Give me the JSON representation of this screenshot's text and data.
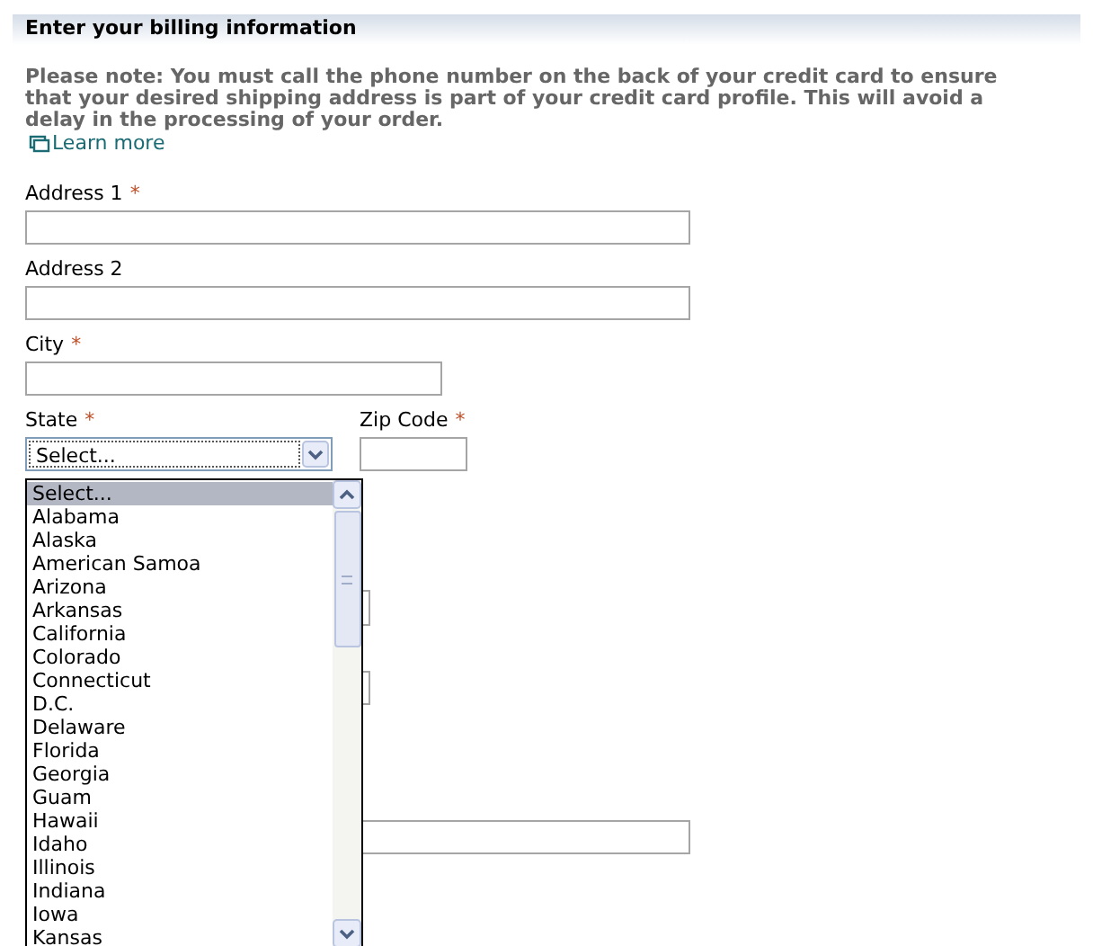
{
  "title": "Enter your billing information",
  "note": "Please note: You must call the phone number on the back of your credit card to ensure that your desired shipping address is part of your credit card profile. This will avoid a delay in the processing of your order.",
  "learn_more": "Learn more",
  "fields": [
    {
      "label": "Address 1",
      "required_mark": "*"
    },
    {
      "label": "Address 2"
    },
    {
      "label": "City",
      "required_mark": "*"
    }
  ],
  "state": {
    "label": "State",
    "required_mark": "*",
    "value": "Select...",
    "options": [
      {
        "label": "Select...",
        "selected": true
      },
      {
        "label": "Alabama",
        "selected": false
      },
      {
        "label": "Alaska",
        "selected": false
      },
      {
        "label": "American Samoa",
        "selected": false
      },
      {
        "label": "Arizona",
        "selected": false
      },
      {
        "label": "Arkansas",
        "selected": false
      },
      {
        "label": "California",
        "selected": false
      },
      {
        "label": "Colorado",
        "selected": false
      },
      {
        "label": "Connecticut",
        "selected": false
      },
      {
        "label": "D.C.",
        "selected": false
      },
      {
        "label": "Delaware",
        "selected": false
      },
      {
        "label": "Florida",
        "selected": false
      },
      {
        "label": "Georgia",
        "selected": false
      },
      {
        "label": "Guam",
        "selected": false
      },
      {
        "label": "Hawaii",
        "selected": false
      },
      {
        "label": "Idaho",
        "selected": false
      },
      {
        "label": "Illinois",
        "selected": false
      },
      {
        "label": "Indiana",
        "selected": false
      },
      {
        "label": "Iowa",
        "selected": false
      },
      {
        "label": "Kansas",
        "selected": false
      }
    ]
  },
  "zip": {
    "label": "Zip Code",
    "required_mark": "*"
  }
}
